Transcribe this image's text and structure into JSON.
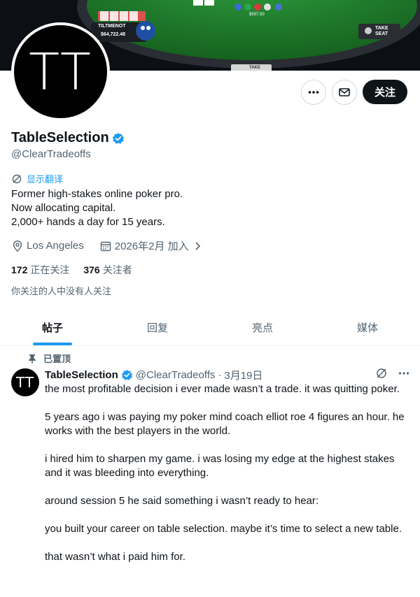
{
  "banner": {
    "player_name": "TILTMENOT",
    "player_stack": "$64,722.48",
    "pot": "$597.50",
    "take_seat": "TAKE SEAT",
    "take_label": "TAKE"
  },
  "profile": {
    "avatar_initials": "TT",
    "display_name": "TableSelection",
    "handle": "@ClearTradeoffs",
    "translate_label": "显示翻译",
    "bio_lines": [
      "Former high-stakes online poker pro.",
      "Now allocating capital.",
      "2,000+ hands a day for 15 years."
    ],
    "location": "Los Angeles",
    "joined": "2026年2月 加入",
    "following_count": "172",
    "following_label": "正在关注",
    "followers_count": "376",
    "followers_label": "关注者",
    "followers_note": "你关注的人中没有人关注"
  },
  "actions": {
    "follow_label": "关注"
  },
  "tabs": [
    {
      "label": "帖子",
      "active": true
    },
    {
      "label": "回复",
      "active": false
    },
    {
      "label": "亮点",
      "active": false
    },
    {
      "label": "媒体",
      "active": false
    }
  ],
  "tweet": {
    "pinned_label": "已置顶",
    "avatar_initials": "TT",
    "name": "TableSelection",
    "handle": "@ClearTradeoffs",
    "separator": "·",
    "date": "3月19日",
    "paragraphs": [
      "the most profitable decision i ever made wasn’t a trade. it was quitting poker.",
      "5 years ago i was paying my poker mind coach elliot roe 4 figures an hour. he works with the best players in the world.",
      "i hired him to sharpen my game. i was losing my edge at the highest stakes and it was bleeding into everything.",
      "around session 5 he said something i wasn’t ready to hear:",
      "you built your career on table selection. maybe it’s time to select a new table.",
      "that wasn’t what i paid him for."
    ]
  },
  "colors": {
    "accent": "#1d9bf0",
    "text": "#0f1419",
    "muted": "#536471",
    "felt": "#1f7a2e"
  }
}
